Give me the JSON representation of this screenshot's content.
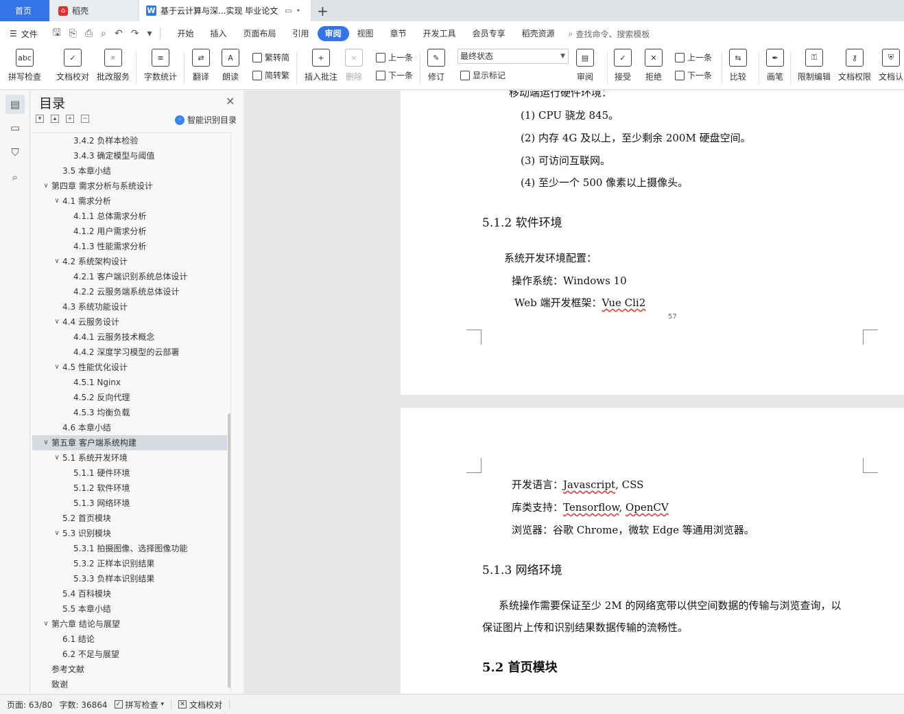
{
  "tabs": {
    "home": "首页",
    "daoke": "稻壳",
    "doc": "基于云计算与深...实现 毕业论文"
  },
  "menu": {
    "file": "文件",
    "items": [
      "开始",
      "插入",
      "页面布局",
      "引用",
      "审阅",
      "视图",
      "章节",
      "开发工具",
      "会员专享",
      "稻壳资源"
    ],
    "active": "审阅",
    "search": "查找命令、搜索模板"
  },
  "ribbon": {
    "spell_check": "拼写检查",
    "doc_proof": "文档校对",
    "batch_service": "批改服务",
    "word_count": "字数统计",
    "translate": "翻译",
    "read_aloud": "朗读",
    "trad_to_simp": "繁转简",
    "simp_to_trad": "简转繁",
    "insert_comment": "插入批注",
    "delete": "删除",
    "prev_comment": "上一条",
    "next_comment": "下一条",
    "revise": "修订",
    "display_mode": "最终状态",
    "show_marks": "显示标记",
    "review": "审阅",
    "accept": "接受",
    "reject": "拒绝",
    "prev_change": "上一条",
    "next_change": "下一条",
    "compare": "比较",
    "pen": "画笔",
    "restrict_edit": "限制编辑",
    "doc_permission": "文档权限",
    "doc_cert": "文档认"
  },
  "toc": {
    "title": "目录",
    "smart": "智能识别目录",
    "items": [
      {
        "text": "3.4.2  负样本检验",
        "level": 3
      },
      {
        "text": "3.4.3  确定模型与阈值",
        "level": 3
      },
      {
        "text": "3.5  本章小结",
        "level": 2
      },
      {
        "text": "第四章  需求分析与系统设计",
        "level": 1,
        "expand": true
      },
      {
        "text": "4.1  需求分析",
        "level": 2,
        "expand": true
      },
      {
        "text": "4.1.1  总体需求分析",
        "level": 3
      },
      {
        "text": "4.1.2  用户需求分析",
        "level": 3
      },
      {
        "text": "4.1.3  性能需求分析",
        "level": 3
      },
      {
        "text": "4.2  系统架构设计",
        "level": 2,
        "expand": true
      },
      {
        "text": "4.2.1  客户端识别系统总体设计",
        "level": 3
      },
      {
        "text": "4.2.2  云服务端系统总体设计",
        "level": 3
      },
      {
        "text": "4.3  系统功能设计",
        "level": 2
      },
      {
        "text": "4.4  云服务设计",
        "level": 2,
        "expand": true
      },
      {
        "text": "4.4.1  云服务技术概念",
        "level": 3
      },
      {
        "text": "4.4.2 深度学习模型的云部署",
        "level": 3
      },
      {
        "text": "4.5  性能优化设计",
        "level": 2,
        "expand": true
      },
      {
        "text": "4.5.1 Nginx",
        "level": 3
      },
      {
        "text": "4.5.2  反向代理",
        "level": 3
      },
      {
        "text": "4.5.3  均衡负载",
        "level": 3
      },
      {
        "text": "4.6 本章小结",
        "level": 2
      },
      {
        "text": "第五章  客户端系统构建",
        "level": 1,
        "expand": true,
        "selected": true
      },
      {
        "text": "5.1 系统开发环境",
        "level": 2,
        "expand": true
      },
      {
        "text": "5.1.1  硬件环境",
        "level": 3
      },
      {
        "text": "5.1.2  软件环境",
        "level": 3
      },
      {
        "text": "5.1.3  网络环境",
        "level": 3
      },
      {
        "text": "5.2  首页模块",
        "level": 2
      },
      {
        "text": "5.3  识别模块",
        "level": 2,
        "expand": true
      },
      {
        "text": "5.3.1  拍摄图像、选择图像功能",
        "level": 3
      },
      {
        "text": "5.3.2  正样本识别结果",
        "level": 3
      },
      {
        "text": "5.3.3  负样本识别结果",
        "level": 3
      },
      {
        "text": "5.4 百科模块",
        "level": 2
      },
      {
        "text": "5.5  本章小结",
        "level": 2
      },
      {
        "text": "第六章  结论与展望",
        "level": 1,
        "expand": true
      },
      {
        "text": "6.1  结论",
        "level": 2
      },
      {
        "text": "6.2  不足与展望",
        "level": 2
      },
      {
        "text": "参考文献",
        "level": 1
      },
      {
        "text": "致谢",
        "level": 1
      }
    ]
  },
  "doc": {
    "page1": {
      "line0": "移动端运行硬件环境：",
      "line1": "(1) CPU 骁龙 845。",
      "line2": "(2)  内存 4G 及以上，至少剩余 200M 硬盘空间。",
      "line3": "(3)  可访问互联网。",
      "line4": "(4)  至少一个 500 像素以上摄像头。",
      "heading": "5.1.2  软件环境",
      "para1": "系统开发环境配置：",
      "para2": "操作系统：Windows 10",
      "para3_prefix": "Web 端开发框架：",
      "para3_link": "Vue Cli2",
      "page_number": "57"
    },
    "page2": {
      "lang_prefix": "开发语言：",
      "lang_a": "Javascript",
      "lang_b": ", CSS",
      "lib_prefix": "库类支持：",
      "lib_a": "Tensorflow",
      "lib_sep": ", ",
      "lib_b": "OpenCV",
      "browser": "浏览器：谷歌 Chrome，微软 Edge 等通用浏览器。",
      "heading": "5.1.3  网络环境",
      "para1": "系统操作需要保证至少 2M 的网络宽带以供空间数据的传输与浏览查询，以",
      "para2": "保证图片上传和识别结果数据传输的流畅性。",
      "heading2": "5.2  首页模块"
    }
  },
  "status": {
    "page": "页面: 63/80",
    "words": "字数: 36864",
    "spell": "拼写检查",
    "proof": "文档校对"
  }
}
